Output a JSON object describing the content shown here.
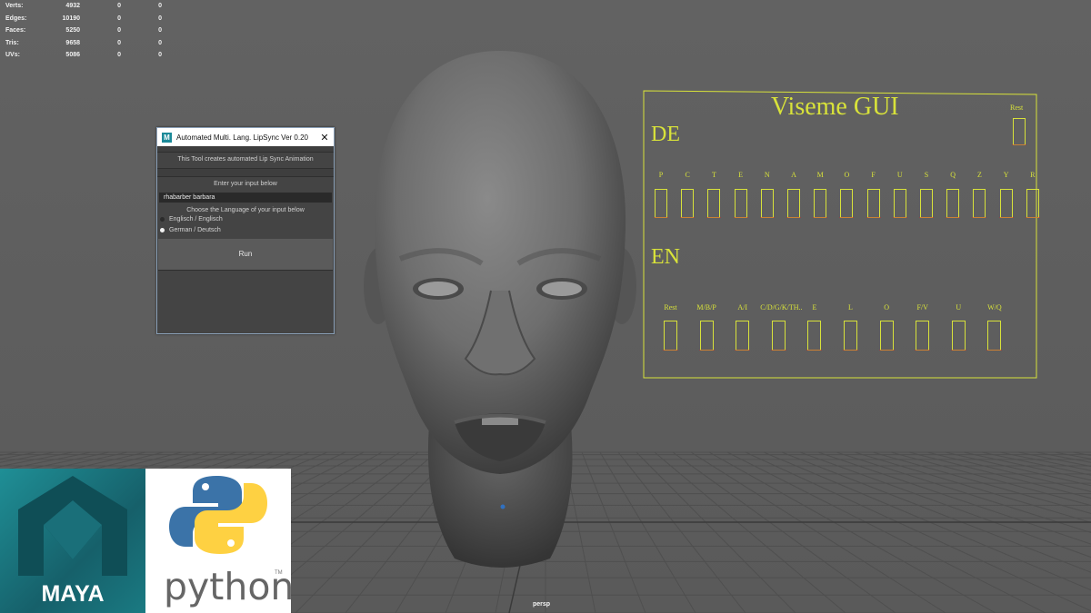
{
  "stats": {
    "rows": [
      {
        "label": "Verts:",
        "value": "4932",
        "a": "0",
        "b": "0"
      },
      {
        "label": "Edges:",
        "value": "10190",
        "a": "0",
        "b": "0"
      },
      {
        "label": "Faces:",
        "value": "5250",
        "a": "0",
        "b": "0"
      },
      {
        "label": "Tris:",
        "value": "9658",
        "a": "0",
        "b": "0"
      },
      {
        "label": "UVs:",
        "value": "5086",
        "a": "0",
        "b": "0"
      }
    ]
  },
  "tool": {
    "title": "Automated Multi. Lang. LipSync Ver 0.20",
    "icon_letter": "M",
    "close_glyph": "✕",
    "description": "This Tool creates automated Lip Sync Animation",
    "enter_label": "Enter your input below",
    "input_value": "rhabarber barbara",
    "language_label": "Choose the Language of your input below",
    "options": [
      {
        "label": "Englisch / Englisch",
        "selected": false
      },
      {
        "label": "German / Deutsch",
        "selected": true
      }
    ],
    "run_label": "Run"
  },
  "viseme": {
    "title": "Viseme GUI",
    "rest_label": "Rest",
    "de_label": "DE",
    "en_label": "EN",
    "de_visemes": [
      "P",
      "C",
      "T",
      "E",
      "N",
      "A",
      "M",
      "O",
      "F",
      "U",
      "S",
      "Q",
      "Z",
      "Y",
      "R"
    ],
    "en_visemes": [
      "Rest",
      "M/B/P",
      "A/I",
      "C/D/G/K/TH..",
      "E",
      "L",
      "O",
      "F/V",
      "U",
      "W/Q"
    ],
    "line_color": "#d8e23a"
  },
  "viewport": {
    "camera_label": "persp"
  },
  "logos": {
    "maya": "MAYA",
    "python": "python",
    "tm": "TM"
  }
}
